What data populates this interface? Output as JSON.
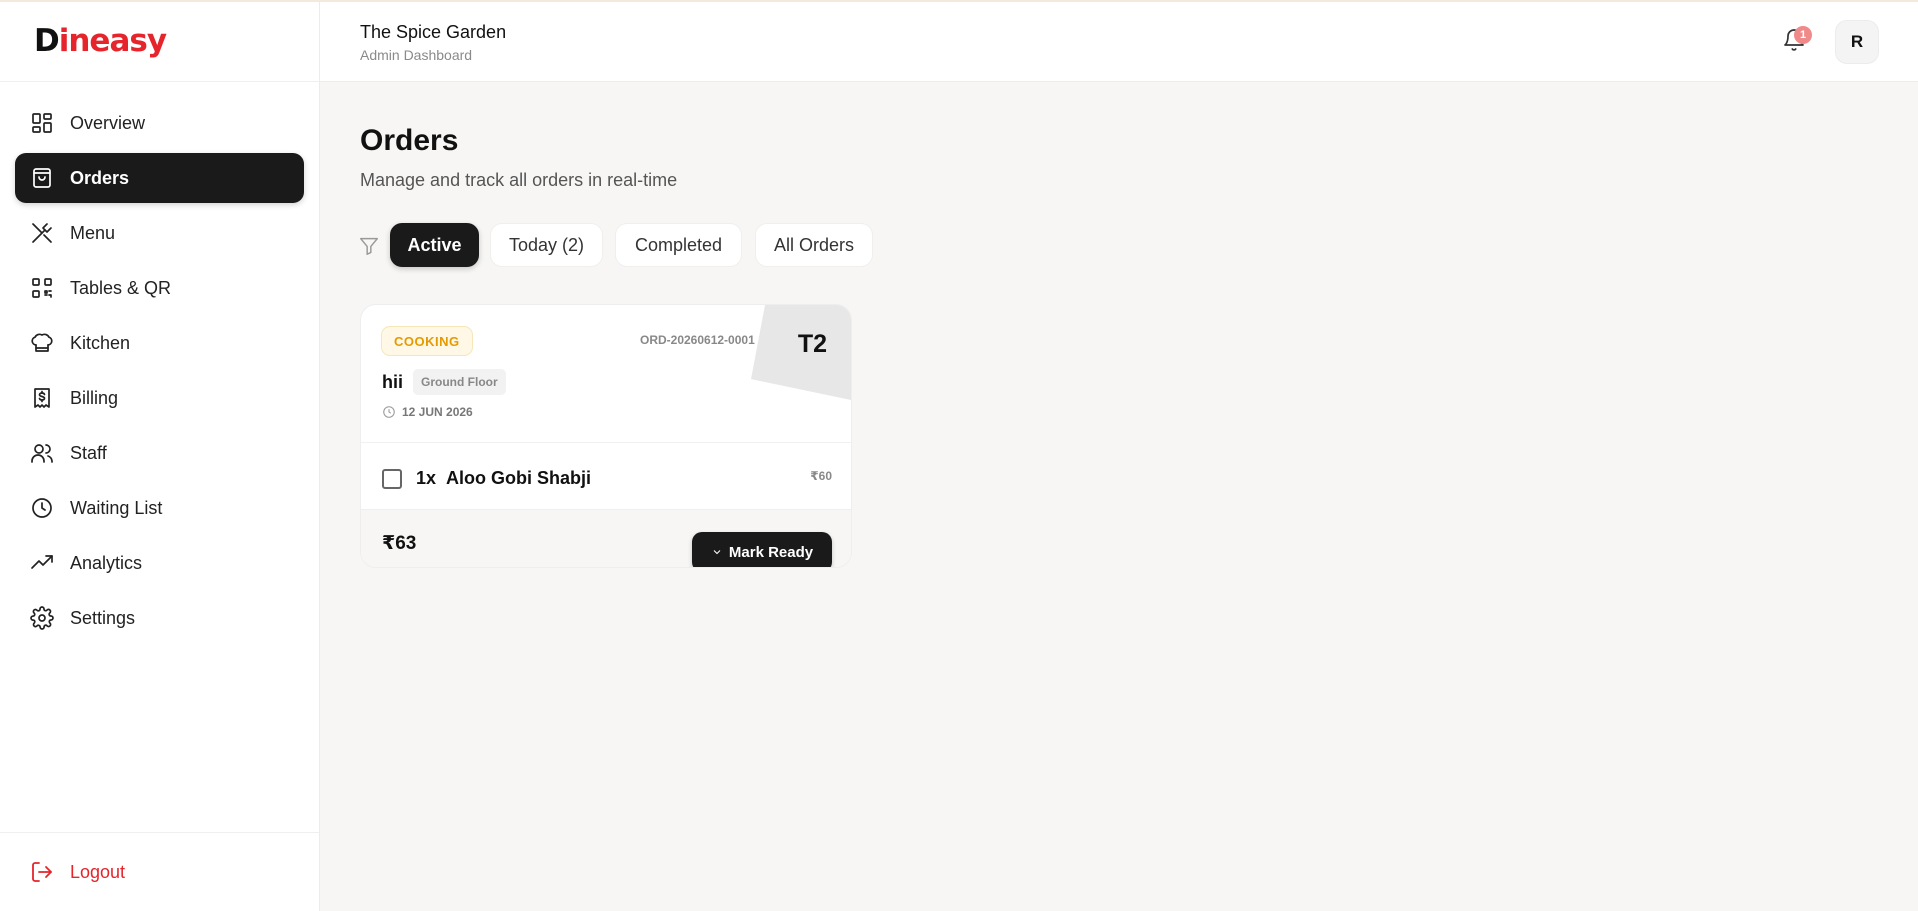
{
  "app": {
    "logo_first": "D",
    "logo_rest": "ineasy",
    "brand_color": "#e5242b"
  },
  "header": {
    "restaurant_name": "The Spice Garden",
    "subtitle": "Admin Dashboard",
    "notification_count": "1",
    "avatar_initial": "R"
  },
  "sidebar": {
    "items": [
      {
        "label": "Overview",
        "icon": "grid-icon",
        "active": false
      },
      {
        "label": "Orders",
        "icon": "shopping-bag-icon",
        "active": true
      },
      {
        "label": "Menu",
        "icon": "utensils-icon",
        "active": false
      },
      {
        "label": "Tables & QR",
        "icon": "qr-code-icon",
        "active": false
      },
      {
        "label": "Kitchen",
        "icon": "chef-hat-icon",
        "active": false
      },
      {
        "label": "Billing",
        "icon": "receipt-icon",
        "active": false
      },
      {
        "label": "Staff",
        "icon": "users-icon",
        "active": false
      },
      {
        "label": "Waiting List",
        "icon": "clock-icon",
        "active": false
      },
      {
        "label": "Analytics",
        "icon": "trending-up-icon",
        "active": false
      },
      {
        "label": "Settings",
        "icon": "gear-icon",
        "active": false
      }
    ],
    "logout_label": "Logout"
  },
  "main": {
    "title": "Orders",
    "subtitle": "Manage and track all orders in real-time",
    "tabs": [
      {
        "label": "Active",
        "active": true
      },
      {
        "label": "Today (2)",
        "active": false
      },
      {
        "label": "Completed",
        "active": false
      },
      {
        "label": "All Orders",
        "active": false
      }
    ],
    "orders": [
      {
        "status": "COOKING",
        "status_color": "#e59a00",
        "order_id": "ORD-20260612-0001",
        "table": "T2",
        "customer": "hii",
        "floor": "Ground Floor",
        "date": "12 JUN 2026",
        "items": [
          {
            "qty": "1x",
            "name": "Aloo Gobi Shabji",
            "price": "₹60"
          }
        ],
        "total": "₹63",
        "action_label": "Mark Ready"
      }
    ]
  }
}
